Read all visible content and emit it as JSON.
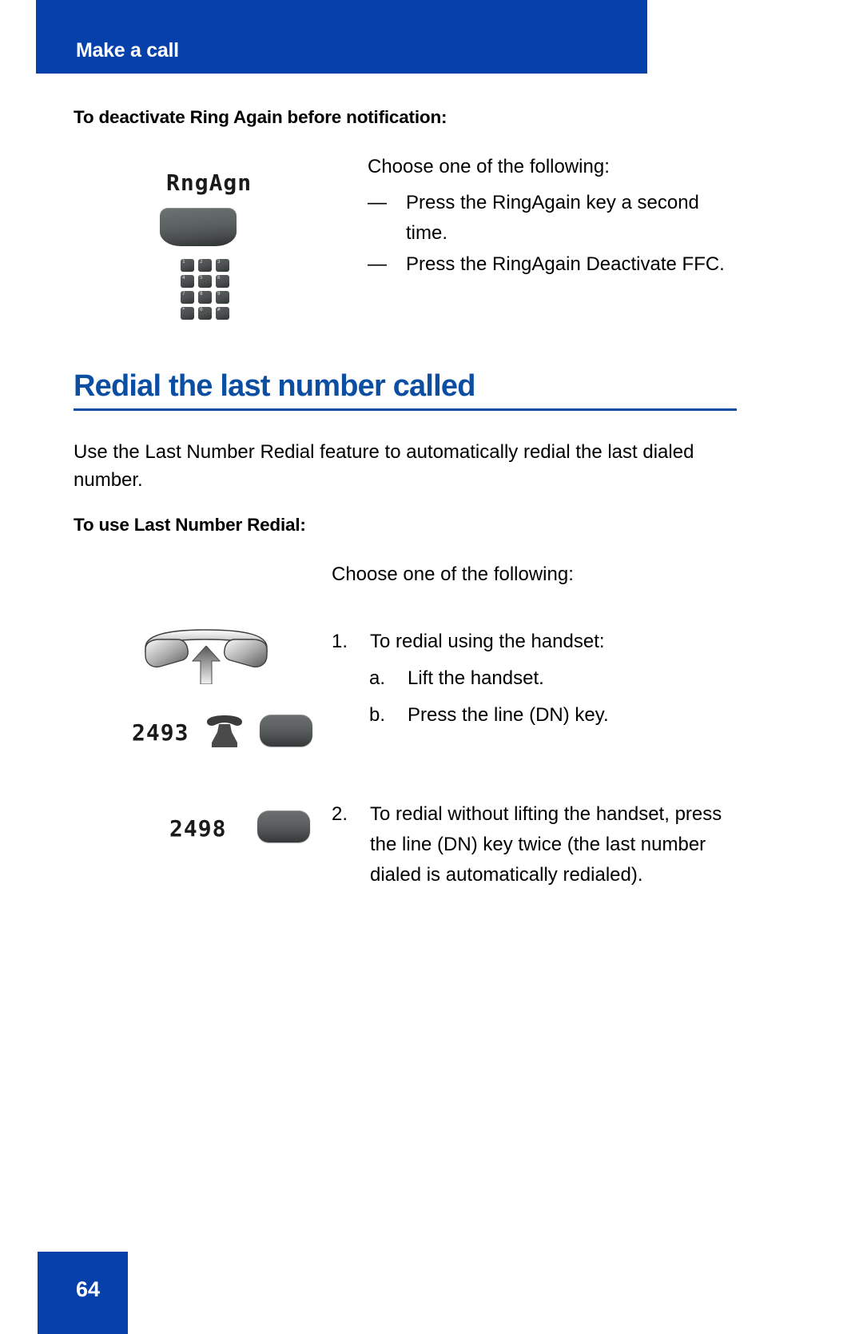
{
  "header": {
    "title": "Make a call"
  },
  "section_ring_again": {
    "heading": "To deactivate Ring Again before notification:",
    "intro": "Choose one of the following:",
    "bullets": [
      {
        "dash": "—",
        "pre": "Press the ",
        "emphasis": "RingAgain",
        "post": " key a second time."
      },
      {
        "dash": "—",
        "pre": "Press the ",
        "emphasis": "RingAgain Deactivate",
        "post": " FFC."
      }
    ],
    "artwork": {
      "softkey_label": "RngAgn",
      "keypad_keys": [
        "1",
        "2",
        "3",
        "4",
        "5",
        "6",
        "7",
        "8",
        "9",
        "*",
        "0",
        "#"
      ]
    }
  },
  "section_redial": {
    "heading": "Redial the last number called",
    "paragraph": "Use the Last Number Redial feature to automatically redial the last dialed number.",
    "sub_heading": "To use Last Number Redial:",
    "intro": "Choose one of the following:",
    "steps": [
      {
        "number": "1.",
        "text": "To redial using the handset:",
        "substeps": [
          {
            "label": "a.",
            "text": "Lift the handset."
          },
          {
            "label": "b.",
            "text": "Press the line (DN) key."
          }
        ]
      },
      {
        "number": "2.",
        "text": "To redial without lifting the handset, press the line (DN) key twice (the last number dialed is automatically redialed)."
      }
    ],
    "artwork": {
      "handset_lcd": "2493",
      "nolift_lcd": "2498"
    }
  },
  "footer": {
    "page_number": "64"
  },
  "colors": {
    "banner_blue": "#0641ab",
    "heading_blue": "#0b4ea2",
    "emphasis_blue": "#0b50a8",
    "text_black": "#000000"
  }
}
